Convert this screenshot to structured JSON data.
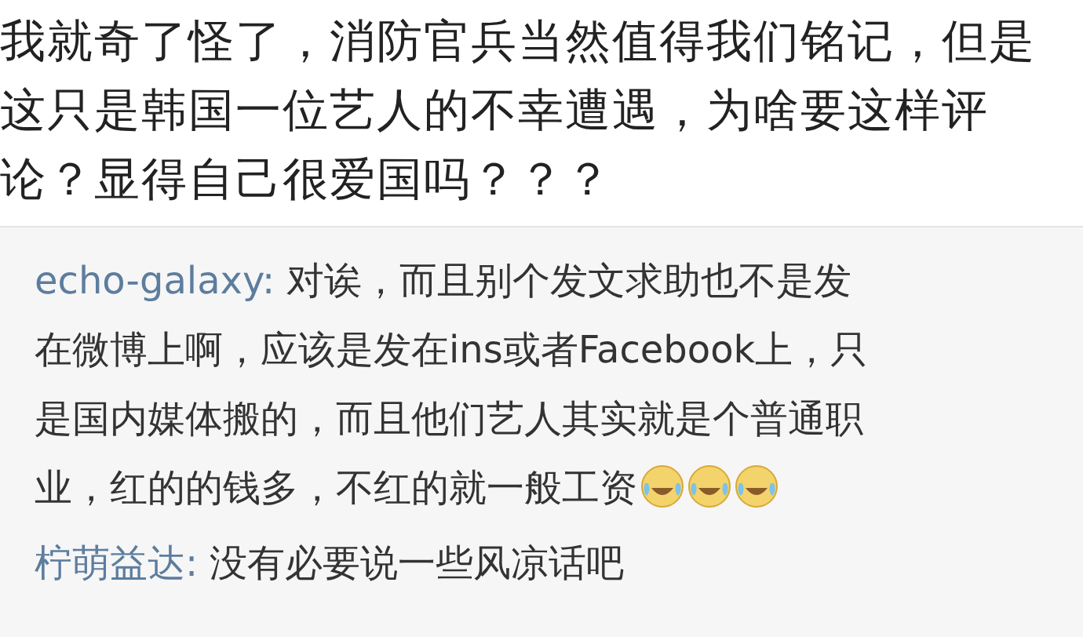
{
  "post": {
    "lines": [
      "我就奇了怪了，消防官兵当然值得我们铭记，但是",
      "这只是韩国一位艺人的不幸遭遇，为啥要这样评",
      "论？显得自己很爱国吗？？？"
    ]
  },
  "replies": [
    {
      "username": "echo-galaxy:",
      "lines": [
        " 对诶，而且别个发文求助也不是发",
        "在微博上啊，应该是发在ins或者Facebook上，只",
        "是国内媒体搬的，而且他们艺人其实就是个普通职",
        "业，红的的钱多，不红的就一般工资"
      ],
      "emojis": [
        {
          "kind": "crying-laughing"
        },
        {
          "kind": "crying-laughing"
        },
        {
          "kind": "crying-laughing"
        }
      ]
    },
    {
      "username": "柠萌益达:",
      "lines": [
        " 没有必要说一些风凉话吧"
      ]
    }
  ]
}
